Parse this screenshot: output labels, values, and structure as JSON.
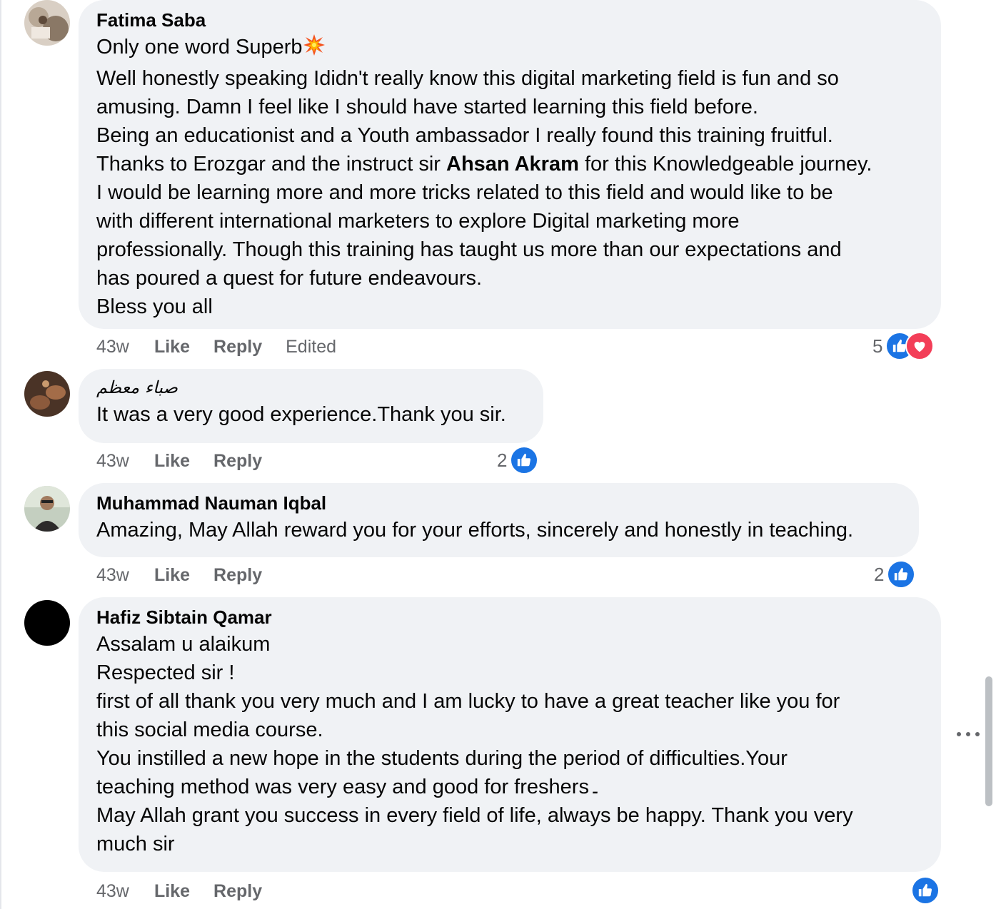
{
  "comments": [
    {
      "author": "Fatima Saba",
      "lines": [
        {
          "text": "Only one word Superb",
          "emoji": "collision"
        },
        {
          "text": "Well honestly speaking Ididn't really know this digital marketing field is fun and so"
        },
        {
          "text": "amusing. Damn I feel like I should have started learning this field before."
        },
        {
          "text": "Being an educationist and a Youth ambassador I really found this training fruitful."
        },
        {
          "pre": "Thanks to Erozgar and the instruct sir ",
          "bold": "Ahsan Akram",
          "post": " for this Knowledgeable journey."
        },
        {
          "text": "I would be learning more and more tricks related to this field and would like to be"
        },
        {
          "text": "with different international marketers to explore Digital marketing more"
        },
        {
          "text": "professionally. Though this training has taught us more than our expectations and"
        },
        {
          "text": "has poured a quest for future endeavours."
        },
        {
          "text": "Bless you all"
        }
      ],
      "time": "43w",
      "like_label": "Like",
      "reply_label": "Reply",
      "edited_label": "Edited",
      "reaction_count": "5",
      "reactions": [
        "like-icon",
        "love-icon"
      ]
    },
    {
      "author": "صباء معظم",
      "lines": [
        {
          "text": "It was a very good experience.Thank you sir."
        }
      ],
      "time": "43w",
      "like_label": "Like",
      "reply_label": "Reply",
      "reaction_count": "2",
      "reactions": [
        "like-icon"
      ]
    },
    {
      "author": "Muhammad Nauman Iqbal",
      "lines": [
        {
          "text": "Amazing, May Allah reward you for your efforts, sincerely and honestly in teaching."
        }
      ],
      "time": "43w",
      "like_label": "Like",
      "reply_label": "Reply",
      "reaction_count": "2",
      "reactions": [
        "like-icon"
      ]
    },
    {
      "author": "Hafiz Sibtain Qamar",
      "lines": [
        {
          "text": "Assalam u alaikum"
        },
        {
          "text": "Respected sir !"
        },
        {
          "text": "first of all thank you very much and I am lucky to have a great teacher like you for"
        },
        {
          "text": "this social media course."
        },
        {
          "text": "You instilled a new hope in the students during the period of difficulties.Your"
        },
        {
          "text": "teaching method was very easy and good for freshers۔"
        },
        {
          "text": "May Allah grant you success in every field of life, always be happy. Thank you very"
        },
        {
          "text": "much sir"
        }
      ],
      "time": "43w",
      "like_label": "Like",
      "reply_label": "Reply",
      "reactions": [
        "like-icon"
      ]
    }
  ],
  "colors": {
    "bubble": "#f0f2f5",
    "meta_text": "#65676b",
    "like_blue": "#1b74e4",
    "love_red": "#f33e58"
  }
}
